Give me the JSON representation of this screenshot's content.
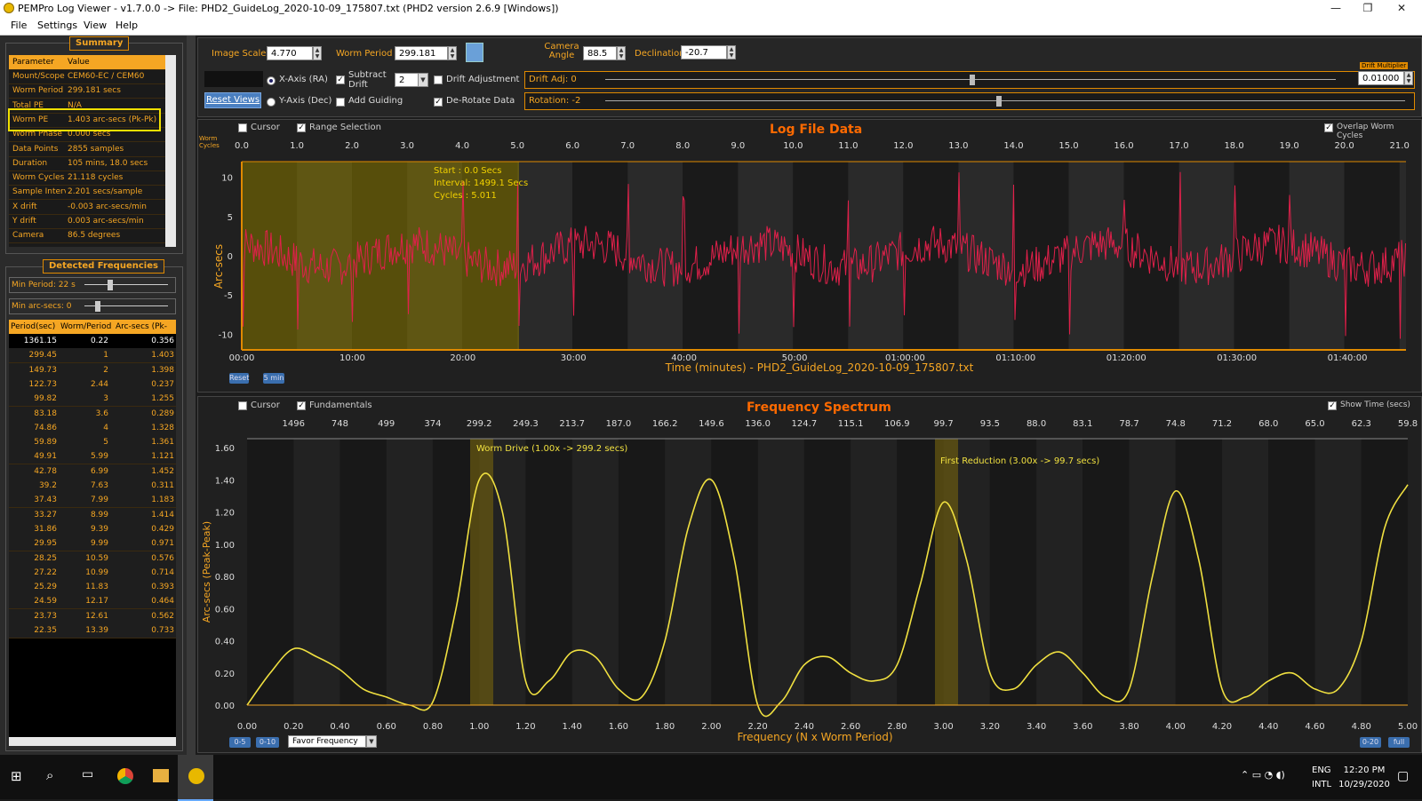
{
  "window": {
    "title": "PEMPro Log Viewer - v1.7.0.0 -> File: PHD2_GuideLog_2020-10-09_175807.txt (PHD2 version 2.6.9 [Windows])"
  },
  "menu": [
    "File",
    "Settings",
    "View",
    "Help"
  ],
  "summary": {
    "title": "Summary",
    "headers": [
      "Parameter",
      "Value"
    ],
    "rows": [
      [
        "Mount/Scope",
        "CEM60-EC / CEM60"
      ],
      [
        "Worm Period",
        "299.181 secs"
      ],
      [
        "Total PE",
        "N/A"
      ],
      [
        "Worm PE",
        "1.403 arc-secs (Pk-Pk)"
      ],
      [
        "Worm Phase",
        "0.000 secs"
      ],
      [
        "Data Points",
        "2855 samples"
      ],
      [
        "Duration",
        "105 mins, 18.0 secs"
      ],
      [
        "Worm Cycles",
        "21.118 cycles"
      ],
      [
        "Sample Interva",
        "2.201 secs/sample"
      ],
      [
        "X drift",
        "-0.003 arc-secs/min"
      ],
      [
        "Y drift",
        "0.003 arc-secs/min"
      ],
      [
        "Camera",
        "86.5 degrees"
      ]
    ]
  },
  "detected": {
    "title": "Detected Frequencies",
    "min_period": "Min Period: 22 s",
    "min_arcsecs": "Min arc-secs: 0",
    "headers": [
      "Period(sec)",
      "Worm/Period",
      "Arc-secs (Pk-Pk)"
    ],
    "rows": [
      [
        "1361.15",
        "0.22",
        "0.356"
      ],
      [
        "299.45",
        "1",
        "1.403"
      ],
      [
        "149.73",
        "2",
        "1.398"
      ],
      [
        "122.73",
        "2.44",
        "0.237"
      ],
      [
        "99.82",
        "3",
        "1.255"
      ],
      [
        "83.18",
        "3.6",
        "0.289"
      ],
      [
        "74.86",
        "4",
        "1.328"
      ],
      [
        "59.89",
        "5",
        "1.361"
      ],
      [
        "49.91",
        "5.99",
        "1.121"
      ],
      [
        "42.78",
        "6.99",
        "1.452"
      ],
      [
        "39.2",
        "7.63",
        "0.311"
      ],
      [
        "37.43",
        "7.99",
        "1.183"
      ],
      [
        "33.27",
        "8.99",
        "1.414"
      ],
      [
        "31.86",
        "9.39",
        "0.429"
      ],
      [
        "29.95",
        "9.99",
        "0.971"
      ],
      [
        "28.25",
        "10.59",
        "0.576"
      ],
      [
        "27.22",
        "10.99",
        "0.714"
      ],
      [
        "25.29",
        "11.83",
        "0.393"
      ],
      [
        "24.59",
        "12.17",
        "0.464"
      ],
      [
        "23.73",
        "12.61",
        "0.562"
      ],
      [
        "22.35",
        "13.39",
        "0.733"
      ]
    ]
  },
  "toolbar": {
    "image_scale_label": "Image Scale",
    "image_scale": "4.770",
    "worm_period_label": "Worm Period",
    "worm_period": "299.181",
    "camera_angle_label": "Camera Angle",
    "camera_angle": "88.5",
    "declination_label": "Declination",
    "declination": "-20.7",
    "x_axis": "X-Axis (RA)",
    "y_axis": "Y-Axis (Dec)",
    "subtract_drift": "Subtract Drift",
    "drift_count": "2",
    "drift_adjustment": "Drift Adjustment",
    "add_guiding": "Add Guiding",
    "derotate": "De-Rotate Data",
    "drift_adj": "Drift Adj: 0",
    "rotation": "Rotation: -2",
    "drift_multiplier_label": "Drift Multiplier",
    "drift_multiplier": "0.01000",
    "reset_views": "Reset Views"
  },
  "log_chart": {
    "title": "Log File Data",
    "cursor": "Cursor",
    "range_selection": "Range Selection",
    "overlap": "Overlap Worm Cycles",
    "worm_cycles_label": "Worm Cycles",
    "ylabel": "Arc-secs",
    "xlabel": "Time (minutes) - PHD2_GuideLog_2020-10-09_175807.txt",
    "top_ticks": [
      "0.0",
      "1.0",
      "2.0",
      "3.0",
      "4.0",
      "5.0",
      "6.0",
      "7.0",
      "8.0",
      "9.0",
      "10.0",
      "11.0",
      "12.0",
      "13.0",
      "14.0",
      "15.0",
      "16.0",
      "17.0",
      "18.0",
      "19.0",
      "20.0",
      "21.0"
    ],
    "y_ticks": [
      "10",
      "5",
      "0",
      "-5",
      "-10"
    ],
    "x_ticks": [
      "00:00",
      "10:00",
      "20:00",
      "30:00",
      "40:00",
      "50:00",
      "01:00:00",
      "01:10:00",
      "01:20:00",
      "01:30:00",
      "01:40:00"
    ],
    "start": "Start   : 0.0 Secs",
    "interval": "Interval: 1499.1 Secs",
    "cycles": "Cycles  : 5.011",
    "reset": "Reset",
    "five_min": "5 min"
  },
  "spectrum": {
    "title": "Frequency Spectrum",
    "cursor": "Cursor",
    "fundamentals": "Fundamentals",
    "show_time": "Show Time (secs)",
    "ylabel": "Arc-secs (Peak-Peak)",
    "xlabel": "Frequency (N x Worm Period)",
    "top_ticks": [
      "1496",
      "748",
      "499",
      "374",
      "299.2",
      "249.3",
      "213.7",
      "187.0",
      "166.2",
      "149.6",
      "136.0",
      "124.7",
      "115.1",
      "106.9",
      "99.7",
      "93.5",
      "88.0",
      "83.1",
      "78.7",
      "74.8",
      "71.2",
      "68.0",
      "65.0",
      "62.3",
      "59.8"
    ],
    "y_ticks": [
      "1.60",
      "1.40",
      "1.20",
      "1.00",
      "0.80",
      "0.60",
      "0.40",
      "0.20",
      "0.00"
    ],
    "x_ticks": [
      "0.00",
      "0.20",
      "0.40",
      "0.60",
      "0.80",
      "1.00",
      "1.20",
      "1.40",
      "1.60",
      "1.80",
      "2.00",
      "2.20",
      "2.40",
      "2.60",
      "2.80",
      "3.00",
      "3.20",
      "3.40",
      "3.60",
      "3.80",
      "4.00",
      "4.20",
      "4.40",
      "4.60",
      "4.80",
      "5.00"
    ],
    "worm_drive": "Worm Drive (1.00x -> 299.2 secs)",
    "first_reduction": "First Reduction (3.00x -> 99.7 secs)",
    "btn_05": "0-5",
    "btn_010": "0-10",
    "favor": "Favor Frequency",
    "btn_020": "0-20",
    "btn_full": "full"
  },
  "chart_data": {
    "type": "line",
    "x": [
      0.0,
      0.1,
      0.2,
      0.3,
      0.4,
      0.5,
      0.6,
      0.7,
      0.8,
      0.9,
      1.0,
      1.1,
      1.2,
      1.3,
      1.4,
      1.5,
      1.6,
      1.7,
      1.8,
      1.9,
      2.0,
      2.1,
      2.2,
      2.3,
      2.4,
      2.5,
      2.6,
      2.7,
      2.8,
      2.9,
      3.0,
      3.1,
      3.2,
      3.3,
      3.4,
      3.5,
      3.6,
      3.7,
      3.8,
      3.9,
      4.0,
      4.1,
      4.2,
      4.3,
      4.4,
      4.5,
      4.6,
      4.7,
      4.8,
      4.9,
      5.0
    ],
    "values": [
      0.0,
      0.2,
      0.35,
      0.3,
      0.22,
      0.1,
      0.05,
      0.0,
      0.02,
      0.6,
      1.4,
      1.2,
      0.15,
      0.15,
      0.33,
      0.3,
      0.1,
      0.05,
      0.4,
      1.1,
      1.4,
      0.9,
      0.0,
      0.02,
      0.25,
      0.3,
      0.2,
      0.15,
      0.25,
      0.75,
      1.26,
      0.9,
      0.2,
      0.1,
      0.25,
      0.33,
      0.2,
      0.05,
      0.1,
      0.8,
      1.33,
      0.9,
      0.1,
      0.05,
      0.15,
      0.2,
      0.1,
      0.1,
      0.4,
      1.1,
      1.37
    ],
    "xlabel": "Frequency (N x Worm Period)",
    "ylabel": "Arc-secs (Peak-Peak)",
    "xlim": [
      0,
      5
    ],
    "ylim": [
      0,
      1.6
    ]
  },
  "taskbar": {
    "lang": "ENG",
    "layout": "INTL",
    "time": "12:20 PM",
    "date": "10/29/2020"
  }
}
